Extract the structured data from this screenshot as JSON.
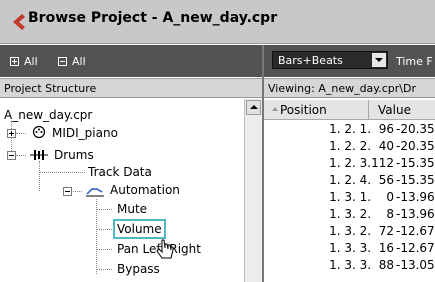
{
  "window": {
    "title": "Browse Project - A_new_day.cpr",
    "title_icon": "arrow-left-icon",
    "accent_color": "#c0392b"
  },
  "toolbar": {
    "expand_all": "All",
    "collapse_all": "All",
    "display_format": "Bars+Beats",
    "time_label": "Time F"
  },
  "tree": {
    "header": "Project Structure",
    "root": "A_new_day.cpr",
    "items": {
      "midi_piano": "MIDI_piano",
      "drums": "Drums",
      "track_data": "Track Data",
      "automation": "Automation",
      "mute": "Mute",
      "volume": "Volume",
      "pan": "Pan Left-Right",
      "bypass": "Bypass"
    },
    "selected": "Volume"
  },
  "events": {
    "viewing": "Viewing: A_new_day.cpr\\Dr",
    "columns": {
      "position": "Position",
      "value": "Value"
    },
    "rows": [
      {
        "position": "1. 2. 1.  96",
        "value": "-20.35"
      },
      {
        "position": "1. 2. 2.  40",
        "value": "-20.35"
      },
      {
        "position": "1. 2. 3.112",
        "value": "-15.35"
      },
      {
        "position": "1. 2. 4.  56",
        "value": "-15.35"
      },
      {
        "position": "1. 3. 1.    0",
        "value": "-13.96"
      },
      {
        "position": "1. 3. 2.    8",
        "value": "-13.96"
      },
      {
        "position": "1. 3. 2.  72",
        "value": "-12.67"
      },
      {
        "position": "1. 3. 3.  16",
        "value": "-12.67"
      },
      {
        "position": "1. 3. 3.  88",
        "value": "-13.05"
      }
    ]
  }
}
